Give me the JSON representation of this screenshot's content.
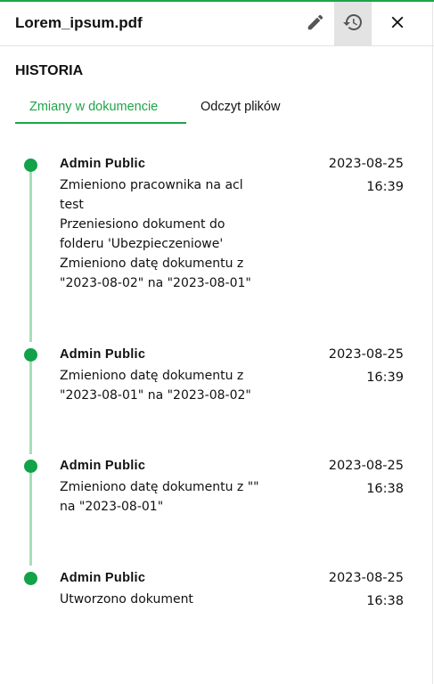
{
  "header": {
    "title": "Lorem_ipsum.pdf",
    "accent_color": "#1fa34a"
  },
  "icons": {
    "edit": "pencil-icon",
    "history": "history-icon",
    "close": "close-icon"
  },
  "history": {
    "section_title": "HISTORIA",
    "tabs": [
      {
        "label": "Zmiany w dokumencie",
        "active": true
      },
      {
        "label": "Odczyt plików",
        "active": false
      }
    ],
    "entries": [
      {
        "author": "Admin Public",
        "date": "2023-08-25",
        "time": "16:39",
        "lines": [
          "Zmieniono pracownika na acl",
          "test",
          "Przeniesiono dokument do",
          "folderu 'Ubezpieczeniowe'",
          "Zmieniono datę dokumentu z",
          "\"2023-08-02\" na \"2023-08-01\""
        ]
      },
      {
        "author": "Admin Public",
        "date": "2023-08-25",
        "time": "16:39",
        "lines": [
          "Zmieniono datę dokumentu z",
          "\"2023-08-01\" na \"2023-08-02\""
        ]
      },
      {
        "author": "Admin Public",
        "date": "2023-08-25",
        "time": "16:38",
        "lines": [
          "Zmieniono datę dokumentu z \"\"",
          "na \"2023-08-01\""
        ]
      },
      {
        "author": "Admin Public",
        "date": "2023-08-25",
        "time": "16:38",
        "lines": [
          "Utworzono dokument"
        ]
      }
    ]
  }
}
